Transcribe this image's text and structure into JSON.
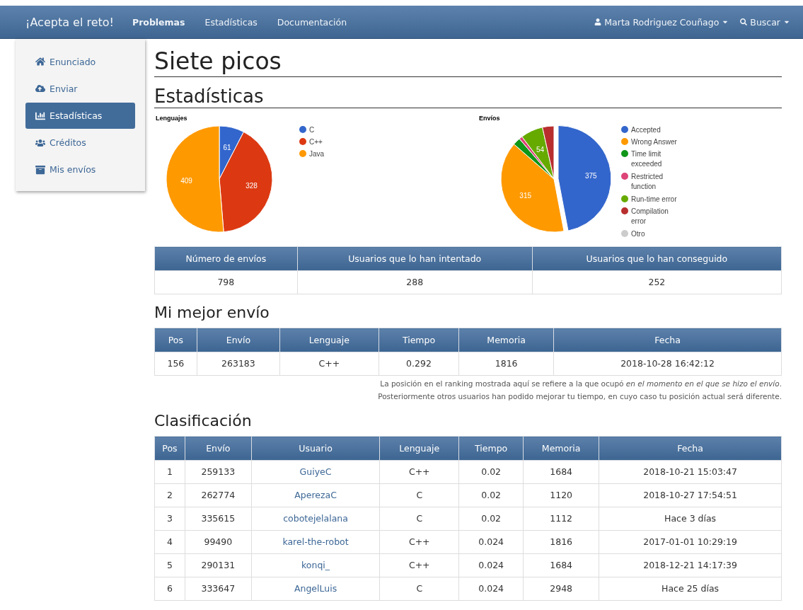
{
  "navbar": {
    "brand": "¡Acepta el reto!",
    "links": [
      {
        "label": "Problemas",
        "selected": true
      },
      {
        "label": "Estadísticas",
        "selected": false
      },
      {
        "label": "Documentación",
        "selected": false
      }
    ],
    "user": "Marta Rodriguez Couñago",
    "search": "Buscar"
  },
  "sidebar": {
    "items": [
      {
        "label": "Enunciado",
        "selected": false
      },
      {
        "label": "Enviar",
        "selected": false
      },
      {
        "label": "Estadísticas",
        "selected": true
      },
      {
        "label": "Créditos",
        "selected": false
      },
      {
        "label": "Mis envíos",
        "selected": false
      }
    ]
  },
  "title": "Siete picos",
  "stats_heading": "Estadísticas",
  "charts": [
    {
      "chart_data": {
        "type": "pie",
        "title": "Lenguajes",
        "categories": [
          "C",
          "C++",
          "Java"
        ],
        "series": [
          {
            "values": [
              7.6,
              41.1,
              51.3
            ]
          }
        ],
        "colors": [
          "#3366cc",
          "#dc3912",
          "#ff9900"
        ],
        "legend": "right",
        "value_labels": [
          "61",
          "328",
          "409"
        ]
      }
    },
    {
      "chart_data": {
        "type": "pie",
        "title": "Envíos",
        "categories": [
          "Accepted",
          "Wrong Answer",
          "Time limit exceeded",
          "Restricted function",
          "Run-time error",
          "Compilation error",
          "Otro"
        ],
        "series": [
          {
            "values": [
              47.0,
              39.4,
              2.3,
              1.0,
              6.8,
              3.5,
              0
            ]
          }
        ],
        "colors": [
          "#3366cc",
          "#ff9900",
          "#109618",
          "#dd4477",
          "#66aa00",
          "#b82e2e",
          "#cccccc"
        ],
        "legend": "right",
        "value_labels": [
          "375",
          "315",
          null,
          null,
          "54",
          null,
          null
        ]
      }
    }
  ],
  "summary_table": {
    "columns": [
      "Número de envíos",
      "Usuarios que lo han intentado",
      "Usuarios que lo han conseguido"
    ],
    "rows": [
      [
        "798",
        "288",
        "252"
      ]
    ]
  },
  "best_heading": "Mi mejor envío",
  "best_table": {
    "columns": [
      "Pos",
      "Envío",
      "Lenguaje",
      "Tiempo",
      "Memoria",
      "Fecha"
    ],
    "rows": [
      [
        "156",
        "263183",
        "C++",
        "0.292",
        "1816",
        "2018-10-28 16:42:12"
      ]
    ]
  },
  "best_notes": [
    "La posición en el ranking mostrada aquí se refiere a la que ocupó *en el momento en el que se hizo el envío*.",
    "Posteriormente otros usuarios han podido mejorar tu tiempo, en cuyo caso tu posición actual será diferente."
  ],
  "ranking_heading": "Clasificación",
  "ranking_table": {
    "columns": [
      "Pos",
      "Envío",
      "Usuario",
      "Lenguaje",
      "Tiempo",
      "Memoria",
      "Fecha"
    ],
    "rows": [
      [
        "1",
        "259133",
        "GuiyeC",
        "C++",
        "0.02",
        "1684",
        "2018-10-21 15:03:47"
      ],
      [
        "2",
        "262774",
        "AperezaC",
        "C",
        "0.02",
        "1120",
        "2018-10-27 17:54:51"
      ],
      [
        "3",
        "335615",
        "cobotejelalana",
        "C",
        "0.02",
        "1112",
        "Hace 3 días"
      ],
      [
        "4",
        "99490",
        "karel-the-robot",
        "C++",
        "0.024",
        "1816",
        "2017-01-01 10:29:19"
      ],
      [
        "5",
        "290131",
        "konqi_",
        "C++",
        "0.024",
        "1684",
        "2018-12-21 14:17:39"
      ],
      [
        "6",
        "333647",
        "AngelLuis",
        "C",
        "0.024",
        "2948",
        "Hace 25 días"
      ]
    ]
  }
}
